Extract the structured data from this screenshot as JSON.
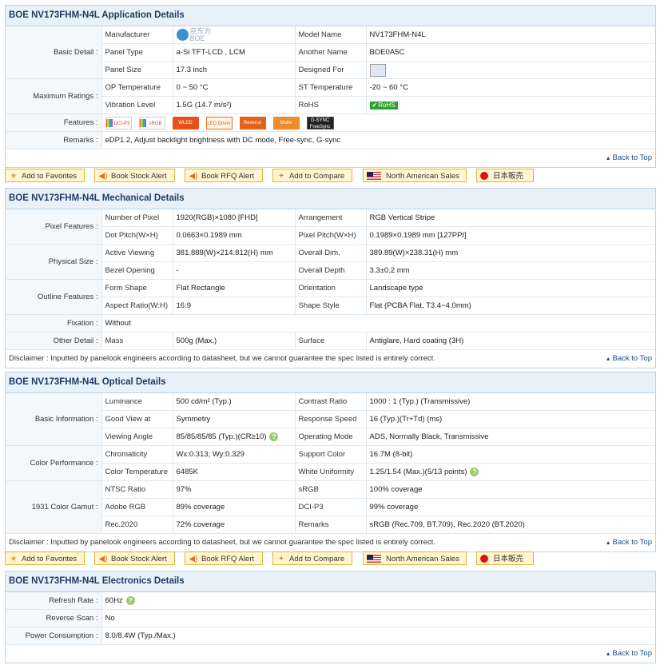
{
  "app": {
    "title": "BOE NV173FHM-N4L Application Details",
    "basic_detail": "Basic Detail :",
    "manufacturer_label": "Manufacturer",
    "manufacturer_logo_text": "京东方",
    "manufacturer_logo_brand": "BOE",
    "model_name_label": "Model Name",
    "model_name": "NV173FHM-N4L",
    "panel_type_label": "Panel Type",
    "panel_type": "a-Si TFT-LCD , LCM",
    "another_name_label": "Another Name",
    "another_name": "BOE0A5C",
    "panel_size_label": "Panel Size",
    "panel_size": "17.3 inch",
    "designed_for_label": "Designed For",
    "designed_for_icon": "laptop-icon",
    "max_ratings": "Maximum Ratings :",
    "op_temp_label": "OP Temperature",
    "op_temp": "0 ~ 50 °C",
    "st_temp_label": "ST Temperature",
    "st_temp": "-20 ~ 60 °C",
    "vibration_label": "Vibration Level",
    "vibration": "1.5G (14.7 m/s²)",
    "rohs_label": "RoHS",
    "rohs_badge": "RoHS",
    "features_label": "Features :",
    "features": [
      "DCI-P3",
      "sRGB",
      "WLED",
      "LED Driver",
      "Reverse",
      "Matte",
      "G-SYNC",
      "FreeSync"
    ],
    "remarks_label": "Remarks :",
    "remarks": "eDP1.2, Adjust backlight brightness with DC mode, Free-sync, G-sync",
    "back_to_top": "Back to Top"
  },
  "buttons": {
    "favorites": "Add to Favorites",
    "stock": "Book Stock Alert",
    "rfq": "Book RFQ Alert",
    "compare": "Add to Compare",
    "na_sales": "North American Sales",
    "jp_sales": "日本販売"
  },
  "mech": {
    "title": "BOE NV173FHM-N4L Mechanical Details",
    "pixel_features": "Pixel Features :",
    "num_pixel_label": "Number of Pixel",
    "num_pixel": "1920(RGB)×1080  [FHD]",
    "arrangement_label": "Arrangement",
    "arrangement": "RGB Vertical Stripe",
    "dot_pitch_label": "Dot Pitch(W×H)",
    "dot_pitch": "0.0663×0.1989 mm",
    "pixel_pitch_label": "Pixel Pitch(W×H)",
    "pixel_pitch": "0.1989×0.1989 mm  [127PPI]",
    "physical_size": "Physical Size :",
    "active_label": "Active Viewing",
    "active": "381.888(W)×214.812(H) mm",
    "overall_dim_label": "Overall Dim.",
    "overall_dim": "389.89(W)×238.31(H) mm",
    "bezel_label": "Bezel Opening",
    "bezel": "-",
    "depth_label": "Overall Depth",
    "depth": "3.3±0.2 mm",
    "outline_features": "Outline Features :",
    "form_label": "Form Shape",
    "form": "Flat Rectangle",
    "orientation_label": "Orientation",
    "orientation": "Landscape type",
    "aspect_label": "Aspect Ratio(W:H)",
    "aspect": "16:9",
    "shape_label": "Shape Style",
    "shape": "Flat (PCBA Flat, T3.4~4.0mm)",
    "fixation_label": "Fixation :",
    "fixation": "Without",
    "other_label": "Other Detail :",
    "mass_label": "Mass",
    "mass": "500g (Max.)",
    "surface_label": "Surface",
    "surface": "Antiglare, Hard coating (3H)",
    "disclaimer": "Disclaimer : Inputted by panelook engineers according to datasheet, but we cannot guarantee the spec listed is entirely correct."
  },
  "optical": {
    "title": "BOE NV173FHM-N4L Optical Details",
    "basic_info": "Basic Information :",
    "luminance_label": "Luminance",
    "luminance": "500 cd/m² (Typ.)",
    "contrast_label": "Contrast Ratio",
    "contrast": "1000 : 1 (Typ.) (Transmissive)",
    "good_view_label": "Good View at",
    "good_view": "Symmetry",
    "response_label": "Response Speed",
    "response": "16 (Typ.)(Tr+Td) (ms)",
    "viewing_label": "Viewing Angle",
    "viewing": "85/85/85/85 (Typ.)(CR≥10)",
    "mode_label": "Operating Mode",
    "mode": "ADS, Normally Black, Transmissive",
    "color_perf": "Color Performance :",
    "chroma_label": "Chromaticity",
    "chroma": "Wx:0.313; Wy:0.329",
    "support_label": "Support Color",
    "support": "16.7M (8-bit)",
    "ctemp_label": "Color Temperature",
    "ctemp": "6485K",
    "white_label": "White Uniformity",
    "white": "1.25/1.54 (Max.)(5/13 points)",
    "gamut": "1931 Color Gamut :",
    "ntsc_label": "NTSC Ratio",
    "ntsc": "97%",
    "srgb_label": "sRGB",
    "srgb": "100% coverage",
    "adobe_label": "Adobe RGB",
    "adobe": "89% coverage",
    "dci_label": "DCI-P3",
    "dci": "99% coverage",
    "rec_label": "Rec.2020",
    "rec": "72% coverage",
    "remarks_label": "Remarks",
    "remarks": "sRGB (Rec.709, BT.709), Rec.2020 (BT.2020)"
  },
  "elec": {
    "title": "BOE NV173FHM-N4L Electronics Details",
    "refresh_label": "Refresh Rate :",
    "refresh": "60Hz",
    "reverse_label": "Reverse Scan :",
    "reverse": "No",
    "power_label": "Power Consumption :",
    "power": "8.0/8.4W (Typ./Max.)"
  }
}
